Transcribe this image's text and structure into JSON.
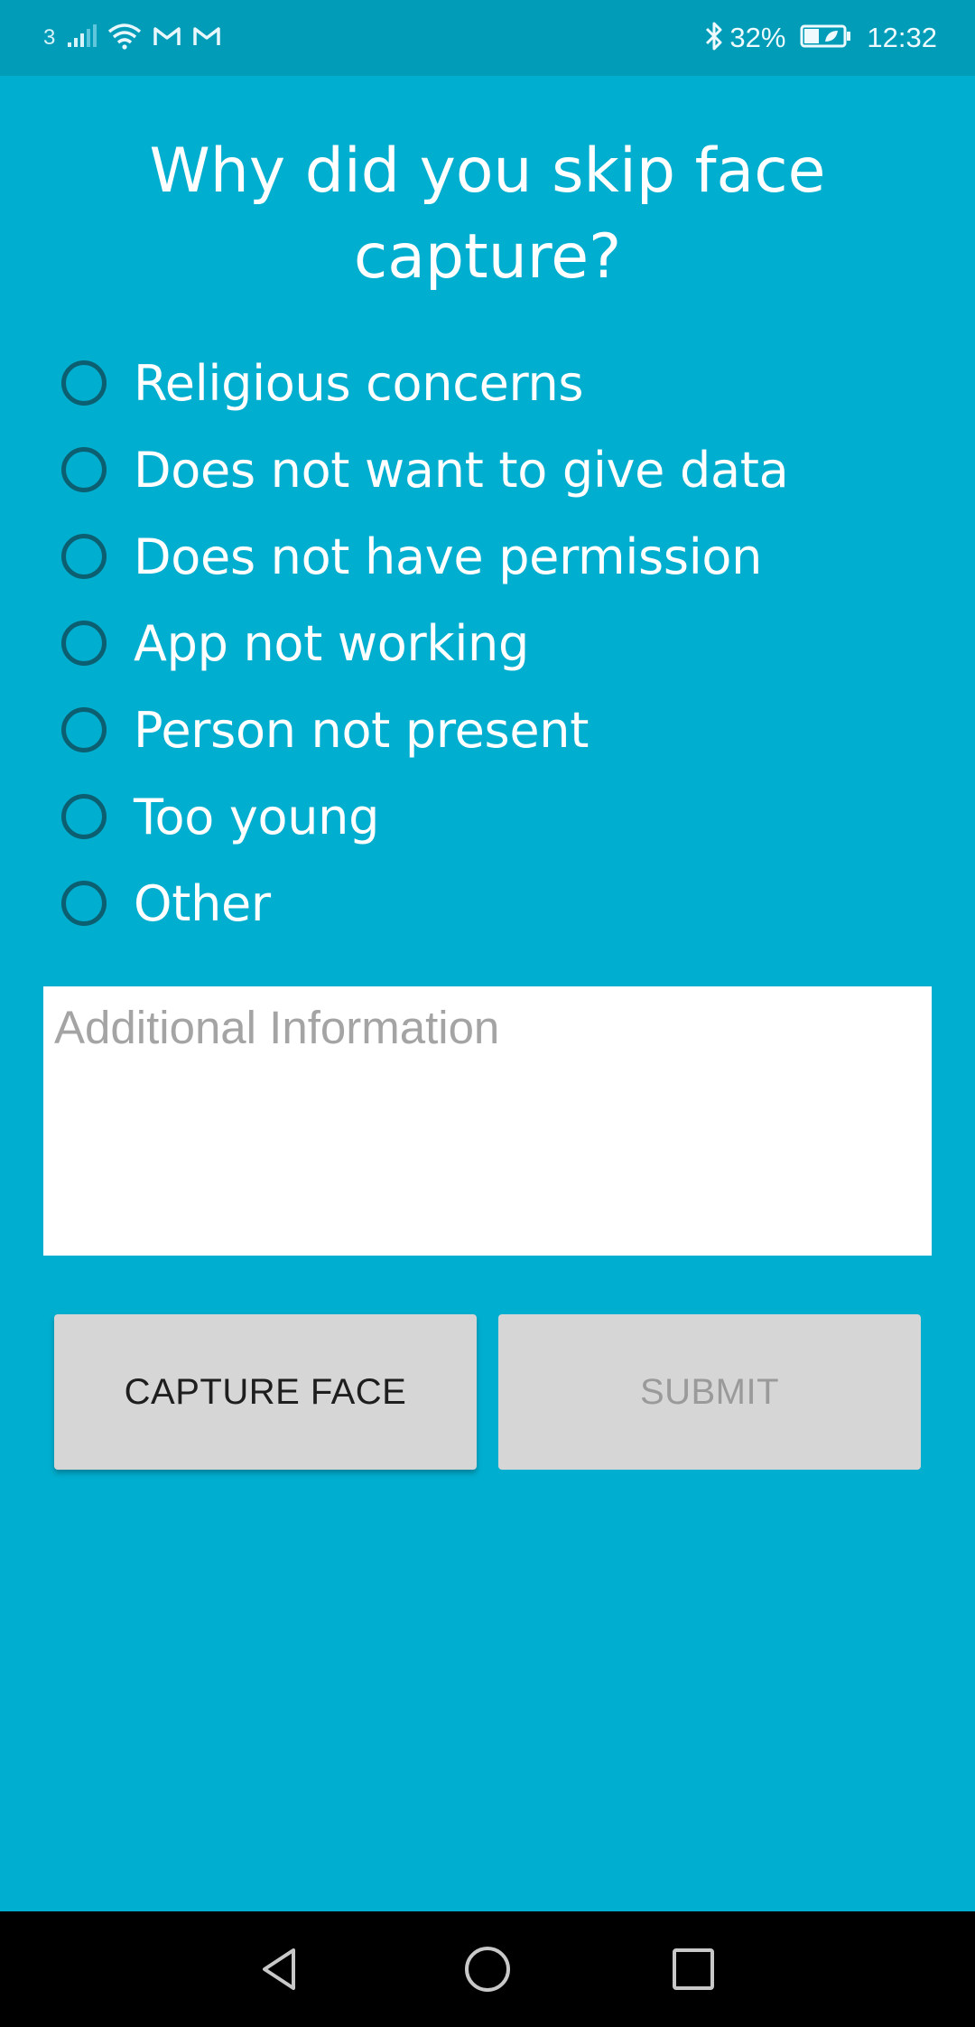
{
  "status_bar": {
    "sim": "3",
    "battery": "32%",
    "time": "12:32",
    "icons": [
      "signal-icon",
      "wifi-icon",
      "gmail-icon",
      "gmail-icon",
      "bluetooth-icon",
      "battery-icon"
    ]
  },
  "title": "Why did you skip face capture?",
  "options": [
    {
      "label": "Religious concerns",
      "selected": false
    },
    {
      "label": "Does not want to give data",
      "selected": false
    },
    {
      "label": "Does not have permission",
      "selected": false
    },
    {
      "label": "App not working",
      "selected": false
    },
    {
      "label": "Person not present",
      "selected": false
    },
    {
      "label": "Too young",
      "selected": false
    },
    {
      "label": "Other",
      "selected": false
    }
  ],
  "additional_info": {
    "placeholder": "Additional Information",
    "value": ""
  },
  "buttons": {
    "capture_face": "CAPTURE FACE",
    "submit": "SUBMIT",
    "submit_enabled": false
  },
  "colors": {
    "background": "#00aecf",
    "status_bar": "#009cb8",
    "radio_ring": "#0c5f70",
    "button": "#d6d6d6"
  },
  "nav_bar": {
    "icons": [
      "back-icon",
      "home-icon",
      "recents-icon"
    ]
  }
}
